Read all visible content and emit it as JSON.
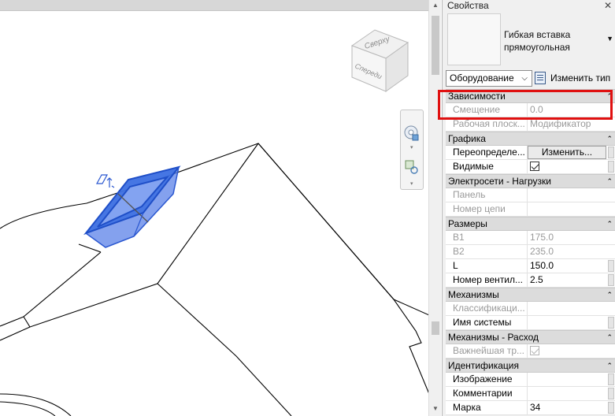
{
  "viewport": {
    "viewcube": {
      "top_label": "Сверху",
      "front_label": "Спереди"
    }
  },
  "properties": {
    "title": "Свойства",
    "close_glyph": "✕",
    "type_name": "Гибкая вставка прямоугольная",
    "category_select": "Оборудование",
    "edit_type_label": "Изменить тип",
    "groups": [
      {
        "label": "Зависимости",
        "rows": [
          {
            "name": "Смещение",
            "value": "0.0",
            "disabled": true
          },
          {
            "name": "Рабочая плоск...",
            "value": "Модификатор",
            "disabled": true
          }
        ]
      },
      {
        "label": "Графика",
        "rows": [
          {
            "name": "Переопределе...",
            "value": "Изменить...",
            "kind": "button"
          },
          {
            "name": "Видимые",
            "value": "",
            "kind": "checkbox",
            "checked": true
          }
        ]
      },
      {
        "label": "Электросети - Нагрузки",
        "rows": [
          {
            "name": "Панель",
            "value": "",
            "disabled": true
          },
          {
            "name": "Номер цепи",
            "value": "",
            "disabled": true
          }
        ]
      },
      {
        "label": "Размеры",
        "rows": [
          {
            "name": "B1",
            "value": "175.0",
            "disabled": true
          },
          {
            "name": "B2",
            "value": "235.0",
            "disabled": true
          },
          {
            "name": "L",
            "value": "150.0"
          },
          {
            "name": "Номер вентил...",
            "value": "2.5"
          }
        ]
      },
      {
        "label": "Механизмы",
        "rows": [
          {
            "name": "Классификаци...",
            "value": "",
            "disabled": true
          },
          {
            "name": "Имя системы",
            "value": ""
          }
        ]
      },
      {
        "label": "Механизмы - Расход",
        "rows": [
          {
            "name": "Важнейшая тр...",
            "value": "",
            "kind": "checkbox",
            "checked": true,
            "disabled": true
          }
        ]
      },
      {
        "label": "Идентификация",
        "rows": [
          {
            "name": "Изображение",
            "value": ""
          },
          {
            "name": "Комментарии",
            "value": ""
          },
          {
            "name": "Марка",
            "value": "34"
          }
        ]
      }
    ]
  },
  "colors": {
    "selection_blue": "#3b6fe0",
    "highlight_red": "#e01010",
    "group_header_bg": "#dcdcdc"
  }
}
